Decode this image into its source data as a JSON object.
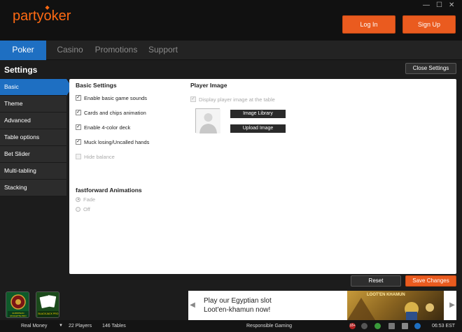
{
  "window": {
    "minimize": "—",
    "maximize": "☐",
    "close": "✕"
  },
  "brand": {
    "name_left": "party",
    "name_right": "ker",
    "o_glyph": "o"
  },
  "header": {
    "login": "Log In",
    "signup": "Sign Up"
  },
  "nav": {
    "tabs": [
      "Poker",
      "Casino",
      "Promotions",
      "Support"
    ]
  },
  "settings": {
    "title": "Settings",
    "close_label": "Close Settings",
    "sidebar": [
      "Basic",
      "Theme",
      "Advanced",
      "Table options",
      "Bet Slider",
      "Multi-tabling",
      "Stacking"
    ],
    "basic": {
      "title": "Basic Settings",
      "options": [
        {
          "label": "Enable basic game sounds",
          "checked": true,
          "disabled": false
        },
        {
          "label": "Cards and chips animation",
          "checked": true,
          "disabled": false
        },
        {
          "label": "Enable 4-color deck",
          "checked": true,
          "disabled": false
        },
        {
          "label": "Muck losing/Uncalled hands",
          "checked": true,
          "disabled": false
        },
        {
          "label": "Hide balance",
          "checked": false,
          "disabled": true
        }
      ]
    },
    "player_image": {
      "title": "Player Image",
      "display_label": "Display player image at the table",
      "library_label": "Image Library",
      "upload_label": "Upload Image"
    },
    "fastforward": {
      "title": "fastforward Animations",
      "options": [
        {
          "label": "Fade",
          "selected": true
        },
        {
          "label": "Off",
          "selected": false
        }
      ]
    },
    "reset_label": "Reset",
    "save_label": "Save Changes"
  },
  "games": [
    {
      "name": "European Roulette Pro",
      "caption": "EUROPEAN ROULETTE PRO"
    },
    {
      "name": "Blackjack Pro",
      "caption": "BLACKJACK PRO"
    }
  ],
  "banner": {
    "line1": "Play our Egyptian slot",
    "line2": "Loot'en-khamun now!",
    "art_title": "LOOT'EN KHAMUN",
    "prev": "◀",
    "next": "▶"
  },
  "statusbar": {
    "mode": "Real Money",
    "players": "22 Players",
    "tables": "146 Tables",
    "responsible": "Responsible Gaming",
    "age": "18+",
    "time": "06:53 EST"
  },
  "colors": {
    "accent_orange": "#ea5b1f",
    "accent_blue": "#1e6fc2",
    "bg": "#1c1c1c"
  }
}
